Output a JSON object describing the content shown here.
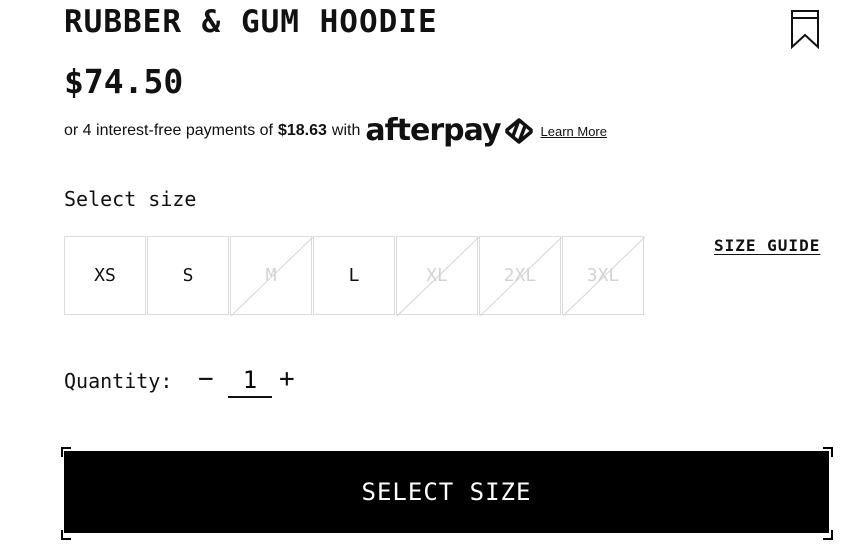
{
  "product": {
    "title": "RUBBER & GUM HOODIE",
    "price": "$74.50"
  },
  "afterpay": {
    "prefix": "or 4 interest-free payments of",
    "amount": "$18.63",
    "with": "with",
    "brand": "afterpay",
    "learn_more": "Learn More"
  },
  "sizes": {
    "label": "Select size",
    "guide": "SIZE GUIDE",
    "options": [
      {
        "label": "XS",
        "available": true
      },
      {
        "label": "S",
        "available": true
      },
      {
        "label": "M",
        "available": false
      },
      {
        "label": "L",
        "available": true
      },
      {
        "label": "XL",
        "available": false
      },
      {
        "label": "2XL",
        "available": false
      },
      {
        "label": "3XL",
        "available": false
      }
    ]
  },
  "quantity": {
    "label": "Quantity:",
    "minus": "−",
    "value": "1",
    "plus": "+"
  },
  "cta": {
    "label": "SELECT SIZE"
  },
  "icons": {
    "bookmark": "bookmark-icon",
    "afterpay_logo": "afterpay-arrows-icon"
  }
}
